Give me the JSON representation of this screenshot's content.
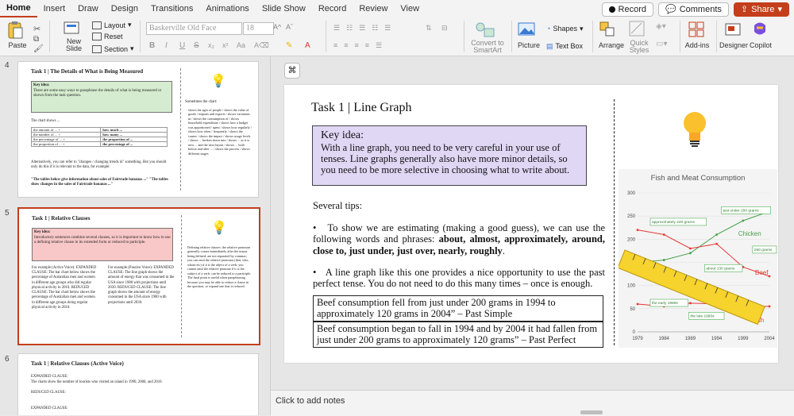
{
  "menu": {
    "tabs": [
      "Home",
      "Insert",
      "Draw",
      "Design",
      "Transitions",
      "Animations",
      "Slide Show",
      "Record",
      "Review",
      "View"
    ],
    "active_tab": "Home",
    "record_label": "Record",
    "comments_label": "Comments",
    "share_label": "Share"
  },
  "ribbon": {
    "paste_label": "Paste",
    "new_slide_label": "New\nSlide",
    "layout_label": "Layout",
    "reset_label": "Reset",
    "section_label": "Section",
    "font_name": "Baskerville Old Face",
    "font_size": "18",
    "convert_label": "Convert to\nSmartArt",
    "picture_label": "Picture",
    "shapes_label": "Shapes",
    "textbox_label": "Text Box",
    "arrange_label": "Arrange",
    "quick_styles_label": "Quick\nStyles",
    "addins_label": "Add-ins",
    "designer_label": "Designer",
    "copilot_label": "Copilot"
  },
  "thumbnails": [
    {
      "number": "4",
      "title": "Task 1 | The Details of What is Being Measured",
      "key_title": "Key idea:",
      "key_text": "There are some easy ways to paraphrase the details of what is being measured or shown from the task question.",
      "chart_shows": "The chart shows ...",
      "table_rows": [
        [
          "the amount of ... +",
          "how much ..."
        ],
        [
          "the number of ... +",
          "how many ..."
        ],
        [
          "the percentage of ... +",
          "the proportion of ..."
        ],
        [
          "the proportion of ... +",
          "the percentage of ..."
        ]
      ],
      "alt_text": "Alternatively, you can refer to \"changes / changing trends in\" something. But you should only do this if it is relevant to the data, for example:",
      "example_text": "\"The tables below give information about sales of Fairtrade bananas ...\" \"The tables show changes in the sales of Fairtrade bananas ...\"",
      "side_title": "Sometimes the chart:",
      "side_items": "shows the ages of people / shows the value of goods / imports and exports / shows variations in / shows the consumption of / shows household expenditure / shows how a budget was apportioned / spent / shows how regularly / shows how often / frequently / shows the causes / shows the impact / shows usage levels / shows ... broken down into / shows ... as it is now ... and the next layout / shows ... both before and after ... / shows the process / shows different stages"
    },
    {
      "number": "5",
      "title": "Task 1 | Relative Clauses",
      "key_title": "Key idea:",
      "key_text": "Introductory sentences combine several clauses, so it is important to know how to use a defining relative clause in its extended form or reduced to participle.",
      "left_col": "For example (Active Voice): EXPANDED CLAUSE: The bar chart below shows the percentage of Australian men and women in different age groups who did regular physical activity in 2010. REDUCED CLAUSE: The bar chart below shows the percentage of Australian men and women in different age groups doing regular physical activity in 2010.",
      "right_col": "For example (Passive Voice): EXPANDED CLAUSE: The line graph shows the amount of energy that was consumed in the USA since 1980 with projections until 2030. REDUCED CLAUSE: The line graph shows the amount of energy consumed in the USA since 1980 with projections until 2030.",
      "side_text": "Defining relative clauses: the relative pronouns generally comes immediately after the nouns being defined; are not separated by commas; you can omit the relative pronouns (that, who, whom etc) if it is the object of a verb; you cannot omit the relative pronoun if it is the subject of a verb; can be reduced to a participle. The final point is useful when paraphrasing because you may be able to reduce a clause in the question, or expand one that is reduced."
    },
    {
      "number": "6",
      "title": "Task 1 | Relative Clauses (Active Voice)",
      "line1": "EXPANDED CLAUSE:",
      "line2": "The charts show the number of tourists who visited an island in 1990, 2000, and 2010.",
      "line3": "REDUCED CLAUSE:",
      "line4": "EXPANDED CLAUSE:"
    }
  ],
  "slide": {
    "title": "Task 1 | Line Graph",
    "key_title": "Key idea:",
    "key_text": "With a line graph, you need to be very careful in your use of tenses. Line graphs generally also have more minor details, so you need to be more selective in choosing what to write about.",
    "tips_title": "Several tips:",
    "tip1_a": "To show we are estimating (making a good guess), we can use the following words and phrases: ",
    "tip1_b": "about, almost, approximately, around, close to, just under, just over, nearly, roughly",
    "tip1_c": ".",
    "tip2": "A line graph like this one provides a nice opportunity to use the past perfect tense. You do not need to do this many times – once is enough.",
    "box1": "Beef consumption fell from just under 200 grams in 1994 to approximately 120 grams in 2004” – Past Simple",
    "box2": "Beef consumption began to fall in 1994 and by 2004 it had fallen from just under 200 grams to approximately 120 grams” – Past Perfect"
  },
  "chart_data": {
    "type": "line",
    "title": "Fish and Meat Consumption",
    "x": [
      1979,
      1984,
      1989,
      1994,
      1999,
      2004
    ],
    "ylim": [
      0,
      300
    ],
    "yticks": [
      0,
      50,
      100,
      150,
      200,
      250,
      300
    ],
    "series": [
      {
        "name": "Chicken",
        "color": "#43a047",
        "values": [
          150,
          155,
          170,
          210,
          240,
          260
        ]
      },
      {
        "name": "Beef",
        "color": "#e53935",
        "values": [
          220,
          210,
          180,
          190,
          140,
          120
        ]
      },
      {
        "name": "Fish",
        "color": "#e53935",
        "values": [
          60,
          55,
          62,
          60,
          55,
          55
        ]
      }
    ],
    "annotations": [
      "approximately 220 grams",
      "just under 200 grams",
      "250 grams",
      "about 130 grams",
      "the early 1980s",
      "the late 1990s",
      "Chicken",
      "Beef",
      "Fish"
    ]
  },
  "notes": {
    "placeholder": "Click to add notes"
  },
  "colors": {
    "accent": "#c43e1c",
    "key_box": "#e0d7f5"
  }
}
